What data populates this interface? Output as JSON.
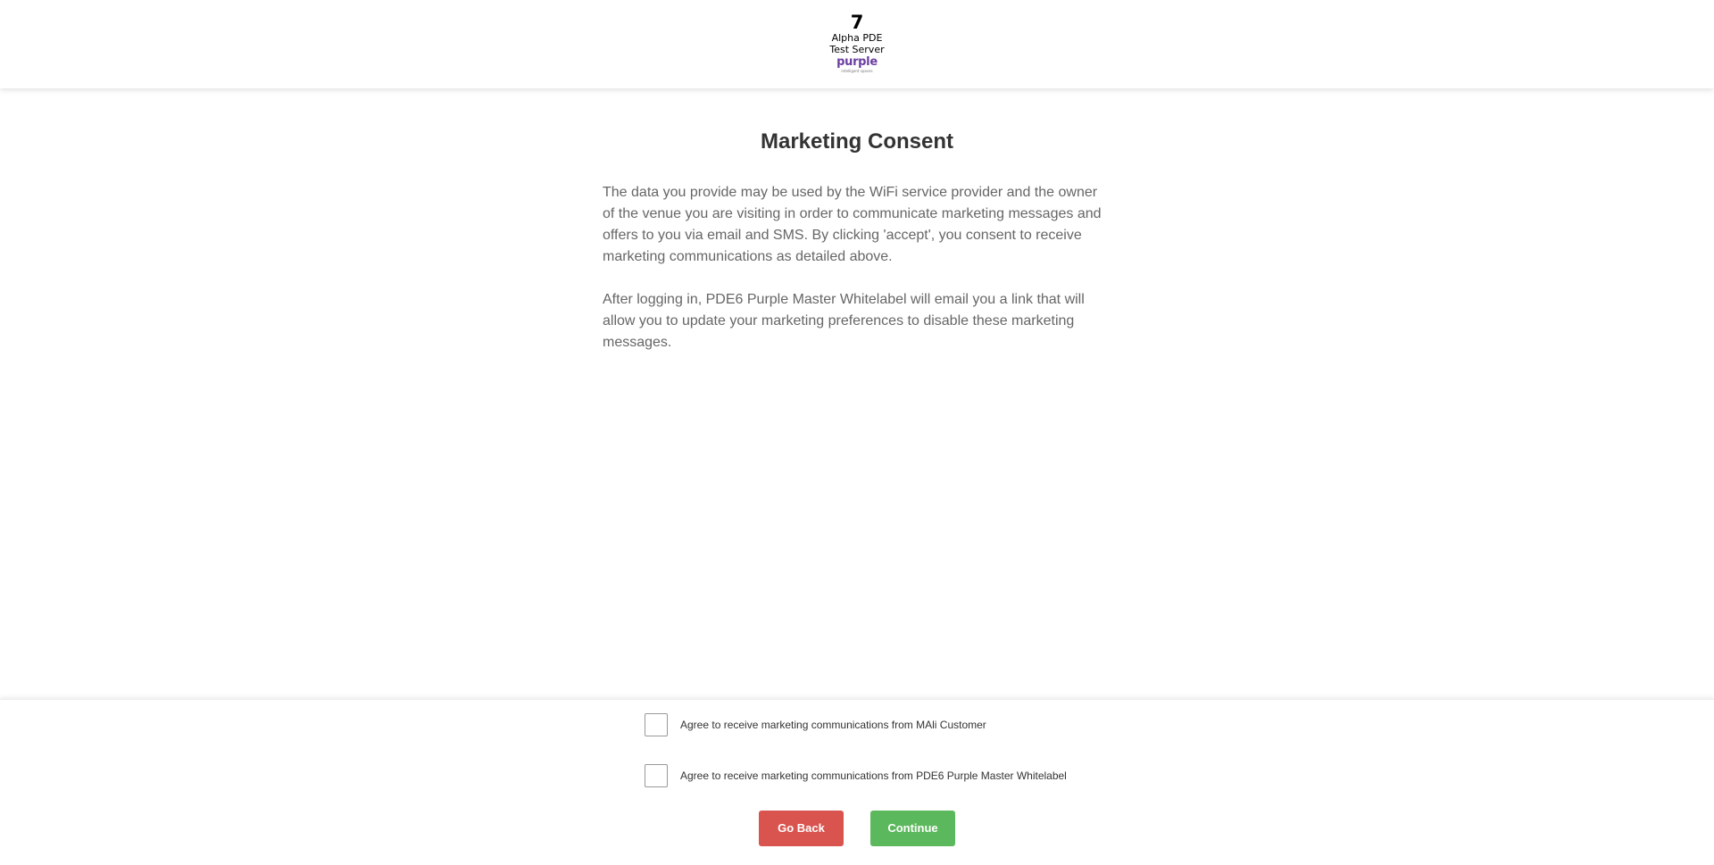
{
  "header": {
    "logo": {
      "number": "7",
      "line1": "Alpha PDE",
      "line2": "Test Server",
      "brand": "purple",
      "tagline": "intelligent spaces"
    }
  },
  "main": {
    "title": "Marketing Consent",
    "paragraphs": [
      "The data you provide may be used by the WiFi service provider and the owner of the venue you are visiting in order to communicate marketing messages and offers to you via email and SMS. By clicking 'accept', you consent to receive marketing communications as detailed above.",
      "After logging in, PDE6 Purple Master Whitelabel will email you a link that will allow you to update your marketing preferences to disable these marketing messages."
    ]
  },
  "consent": {
    "options": [
      {
        "label": "Agree to receive marketing communications from MAli Customer",
        "checked": false
      },
      {
        "label": "Agree to receive marketing communications from PDE6 Purple Master Whitelabel",
        "checked": false
      }
    ]
  },
  "actions": {
    "back_label": "Go Back",
    "continue_label": "Continue"
  },
  "colors": {
    "back_button": "#d9534f",
    "continue_button": "#5cb85c",
    "brand_purple": "#6b3fa0",
    "title_text": "#333333",
    "body_text": "#666666"
  },
  "icons": {
    "logo": "alpha-pde-purple-logo"
  }
}
